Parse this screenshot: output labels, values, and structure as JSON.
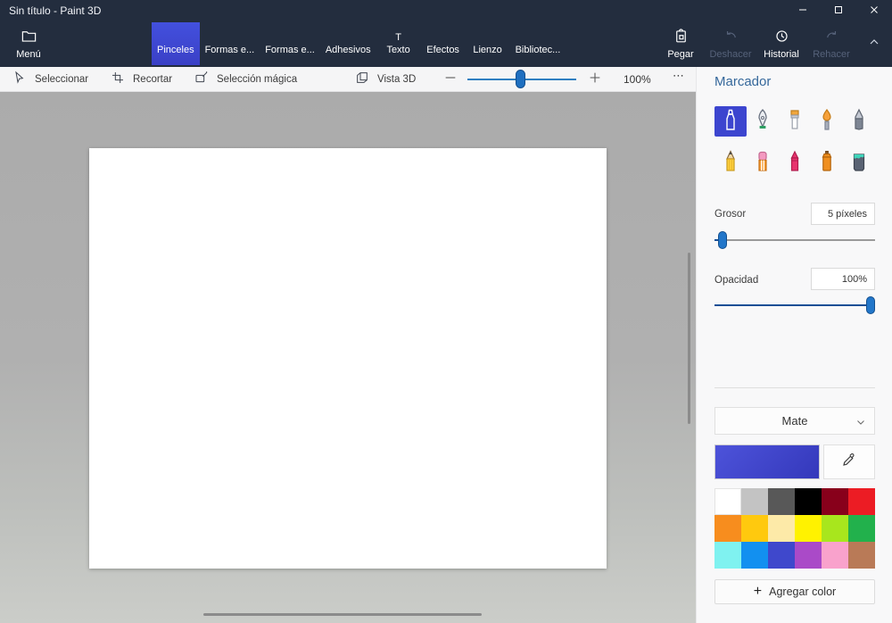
{
  "window": {
    "title": "Sin título - Paint 3D"
  },
  "ribbon": {
    "menu_label": "Menú",
    "tabs": [
      {
        "label": "Pinceles",
        "icon": "brush-icon",
        "selected": true
      },
      {
        "label": "Formas e...",
        "icon": "shapes-2d-icon",
        "selected": false
      },
      {
        "label": "Formas e...",
        "icon": "cube-3d-icon",
        "selected": false
      },
      {
        "label": "Adhesivos",
        "icon": "sticker-icon",
        "selected": false
      },
      {
        "label": "Texto",
        "icon": "text-icon",
        "selected": false
      },
      {
        "label": "Efectos",
        "icon": "effects-icon",
        "selected": false
      },
      {
        "label": "Lienzo",
        "icon": "canvas-icon",
        "selected": false
      },
      {
        "label": "Bibliotec...",
        "icon": "library-icon",
        "selected": false
      }
    ],
    "paste_label": "Pegar",
    "undo_label": "Deshacer",
    "undo_enabled": false,
    "history_label": "Historial",
    "redo_label": "Rehacer",
    "redo_enabled": false
  },
  "toolbar": {
    "select_label": "Seleccionar",
    "crop_label": "Recortar",
    "magic_select_label": "Selección mágica",
    "view3d_label": "Vista 3D",
    "zoom_value": "100%",
    "more_icon": "⋯"
  },
  "panel": {
    "title": "Marcador",
    "brushes": [
      "marker",
      "calligraphy-pen",
      "oil-brush",
      "watercolor",
      "pixel-pen",
      "pencil",
      "eraser",
      "crayon",
      "spray-can",
      "fill-bucket"
    ],
    "selected_brush": "marker",
    "thickness_label": "Grosor",
    "thickness_value": "5 píxeles",
    "opacity_label": "Opacidad",
    "opacity_value": "100%",
    "material_value": "Mate",
    "current_color": "linear-gradient(135deg,#4d53da,#3438bb)",
    "palette": [
      "#ffffff",
      "#c3c3c3",
      "#585858",
      "#000000",
      "#88001b",
      "#ec1c24",
      "#f78d1e",
      "#ffc90e",
      "#fdeaa8",
      "#fff200",
      "#a8e61d",
      "#22b14c",
      "#7ff2f0",
      "#1290f0",
      "#3f48cc",
      "#aa4ac8",
      "#f9a2cc",
      "#b97a57"
    ],
    "add_color_label": "Agregar color"
  }
}
